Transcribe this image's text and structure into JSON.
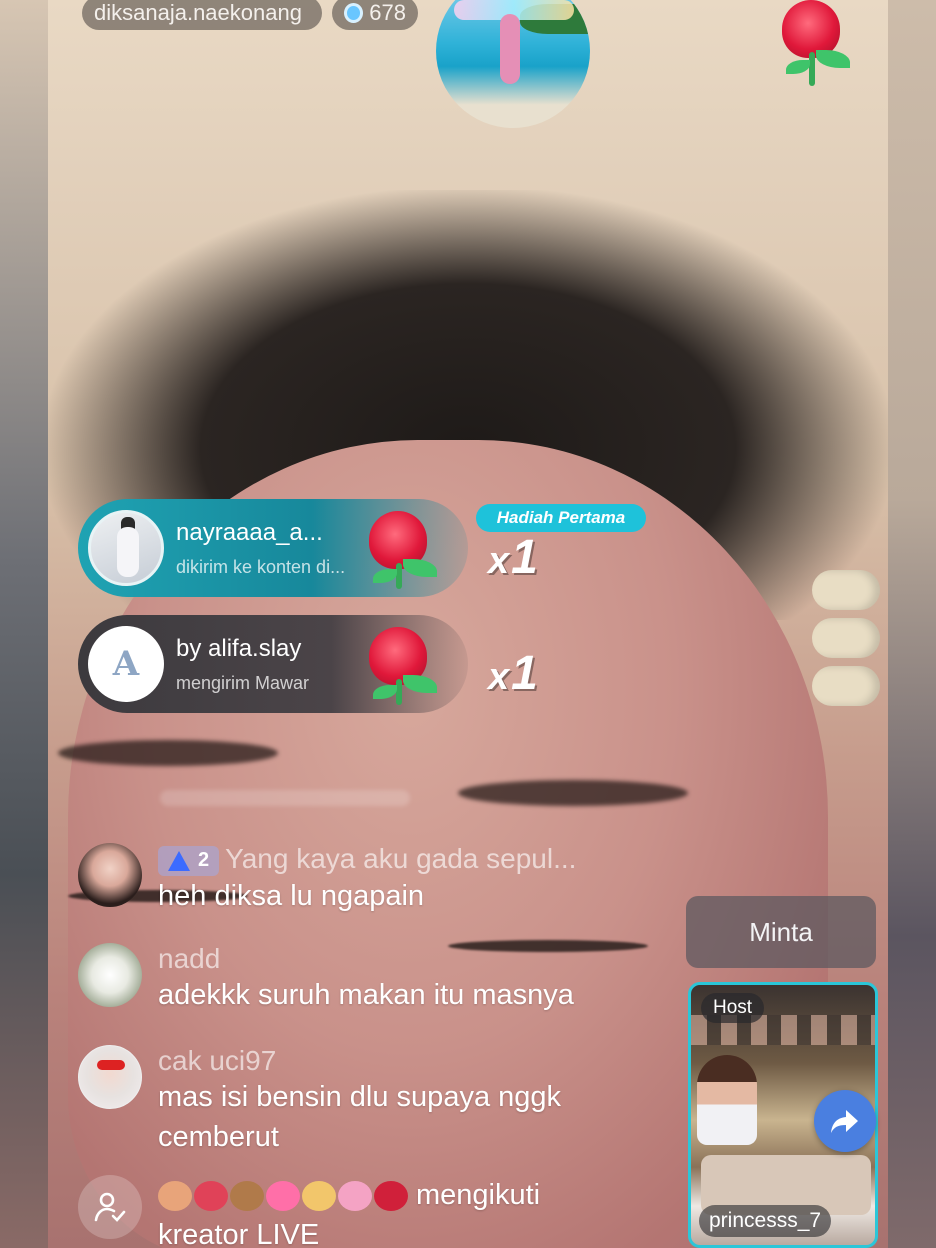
{
  "header": {
    "host_name": "diksanaja.naekonang",
    "viewer_count": "678"
  },
  "gifts": [
    {
      "sender": "nayraaaa_a...",
      "subtitle": "dikirim ke konten di...",
      "multiplier": "1",
      "badge": "Hadiah Pertama"
    },
    {
      "sender": "by alifa.slay",
      "subtitle": "mengirim Mawar",
      "multiplier": "1"
    }
  ],
  "chat": [
    {
      "badge_level": "2",
      "name": "Yang kaya aku gada sepul...",
      "message": "heh diksa lu ngapain"
    },
    {
      "name": "nadd",
      "message": "adekkk suruh makan itu masnya"
    },
    {
      "name": "cak uci97",
      "message": "mas isi bensin dlu supaya nggk cemberut"
    },
    {
      "message": "mengikuti kreator LIVE"
    }
  ],
  "sidebar": {
    "request_label": "Minta",
    "guest": {
      "host_tag": "Host",
      "name": "princesss_7"
    }
  },
  "colors": {
    "gift_first": "#17889b",
    "badge": "#1ec2da",
    "share": "#4a7fe0",
    "guest_border": "#2bc6d8"
  }
}
